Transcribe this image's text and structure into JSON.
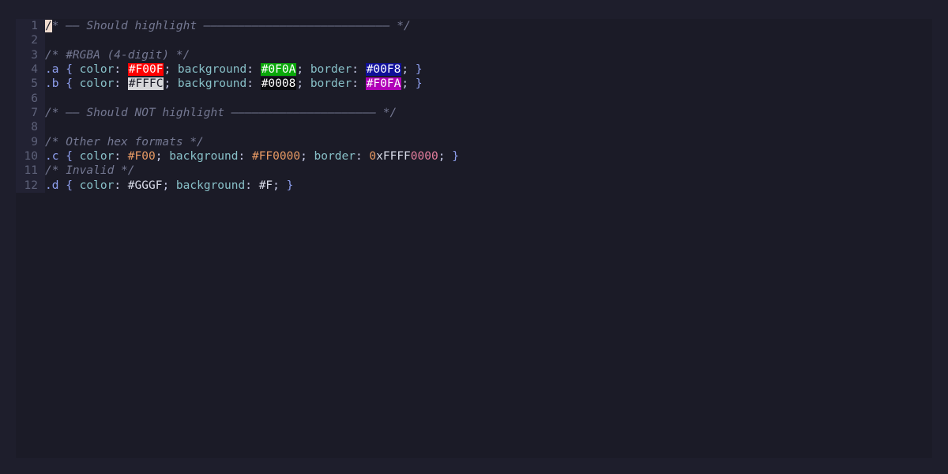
{
  "editor": {
    "lines": [
      {
        "n": "1",
        "tokens": [
          {
            "t": "/",
            "c": "t-cursor"
          },
          {
            "t": "* —— Should highlight ——————————————————————————— */",
            "c": "t-comment"
          }
        ]
      },
      {
        "n": "2",
        "tokens": []
      },
      {
        "n": "3",
        "tokens": [
          {
            "t": "/* #RGBA (4-digit) */",
            "c": "t-comment"
          }
        ]
      },
      {
        "n": "4",
        "tokens": [
          {
            "t": ".a",
            "c": "t-selector"
          },
          {
            "t": " { ",
            "c": "t-brace"
          },
          {
            "t": "color",
            "c": "t-prop"
          },
          {
            "t": ": ",
            "c": "t-punct"
          },
          {
            "t": "#F00F",
            "c": "sw",
            "bg": "#ff0000",
            "fg": "#ffffff"
          },
          {
            "t": "; ",
            "c": "t-punct"
          },
          {
            "t": "background",
            "c": "t-prop"
          },
          {
            "t": ": ",
            "c": "t-punct"
          },
          {
            "t": "#0F0A",
            "c": "sw",
            "bg": "#0aa80a",
            "fg": "#ffffff"
          },
          {
            "t": "; ",
            "c": "t-punct"
          },
          {
            "t": "border",
            "c": "t-prop"
          },
          {
            "t": ": ",
            "c": "t-punct"
          },
          {
            "t": "#00F8",
            "c": "sw",
            "bg": "#10109a",
            "fg": "#ffffff"
          },
          {
            "t": "; ",
            "c": "t-punct"
          },
          {
            "t": "}",
            "c": "t-brace"
          }
        ]
      },
      {
        "n": "5",
        "tokens": [
          {
            "t": ".b",
            "c": "t-selector"
          },
          {
            "t": " { ",
            "c": "t-brace"
          },
          {
            "t": "color",
            "c": "t-prop"
          },
          {
            "t": ": ",
            "c": "t-punct"
          },
          {
            "t": "#FFFC",
            "c": "sw",
            "bg": "#d7d7da",
            "fg": "#1b1b27"
          },
          {
            "t": "; ",
            "c": "t-punct"
          },
          {
            "t": "background",
            "c": "t-prop"
          },
          {
            "t": ": ",
            "c": "t-punct"
          },
          {
            "t": "#0008",
            "c": "sw",
            "bg": "#0a0a0e",
            "fg": "#ffffff"
          },
          {
            "t": "; ",
            "c": "t-punct"
          },
          {
            "t": "border",
            "c": "t-prop"
          },
          {
            "t": ": ",
            "c": "t-punct"
          },
          {
            "t": "#F0FA",
            "c": "sw",
            "bg": "#b000b8",
            "fg": "#ffffff"
          },
          {
            "t": "; ",
            "c": "t-punct"
          },
          {
            "t": "}",
            "c": "t-brace"
          }
        ]
      },
      {
        "n": "6",
        "tokens": []
      },
      {
        "n": "7",
        "tokens": [
          {
            "t": "/* —— Should NOT highlight ————————————————————— */",
            "c": "t-comment"
          }
        ]
      },
      {
        "n": "8",
        "tokens": []
      },
      {
        "n": "9",
        "tokens": [
          {
            "t": "/* Other hex formats */",
            "c": "t-comment"
          }
        ]
      },
      {
        "n": "10",
        "tokens": [
          {
            "t": ".c",
            "c": "t-selector"
          },
          {
            "t": " { ",
            "c": "t-brace"
          },
          {
            "t": "color",
            "c": "t-prop"
          },
          {
            "t": ": ",
            "c": "t-punct"
          },
          {
            "t": "#F00",
            "c": "t-hex"
          },
          {
            "t": "; ",
            "c": "t-punct"
          },
          {
            "t": "background",
            "c": "t-prop"
          },
          {
            "t": ": ",
            "c": "t-punct"
          },
          {
            "t": "#FF0000",
            "c": "t-hex"
          },
          {
            "t": "; ",
            "c": "t-punct"
          },
          {
            "t": "border",
            "c": "t-prop"
          },
          {
            "t": ": ",
            "c": "t-punct"
          },
          {
            "t": "0",
            "c": "t-hex"
          },
          {
            "t": "xFFFF",
            "c": "t-plain"
          },
          {
            "t": "0000",
            "c": "t-pink"
          },
          {
            "t": "; ",
            "c": "t-punct"
          },
          {
            "t": "}",
            "c": "t-brace"
          }
        ]
      },
      {
        "n": "11",
        "tokens": [
          {
            "t": "/* Invalid */",
            "c": "t-comment"
          }
        ]
      },
      {
        "n": "12",
        "tokens": [
          {
            "t": ".d",
            "c": "t-selector"
          },
          {
            "t": " { ",
            "c": "t-brace"
          },
          {
            "t": "color",
            "c": "t-prop"
          },
          {
            "t": ": ",
            "c": "t-punct"
          },
          {
            "t": "#GGGF",
            "c": "t-plain"
          },
          {
            "t": "; ",
            "c": "t-punct"
          },
          {
            "t": "background",
            "c": "t-prop"
          },
          {
            "t": ": ",
            "c": "t-punct"
          },
          {
            "t": "#F",
            "c": "t-plain"
          },
          {
            "t": "; ",
            "c": "t-punct"
          },
          {
            "t": "}",
            "c": "t-brace"
          }
        ]
      }
    ]
  }
}
